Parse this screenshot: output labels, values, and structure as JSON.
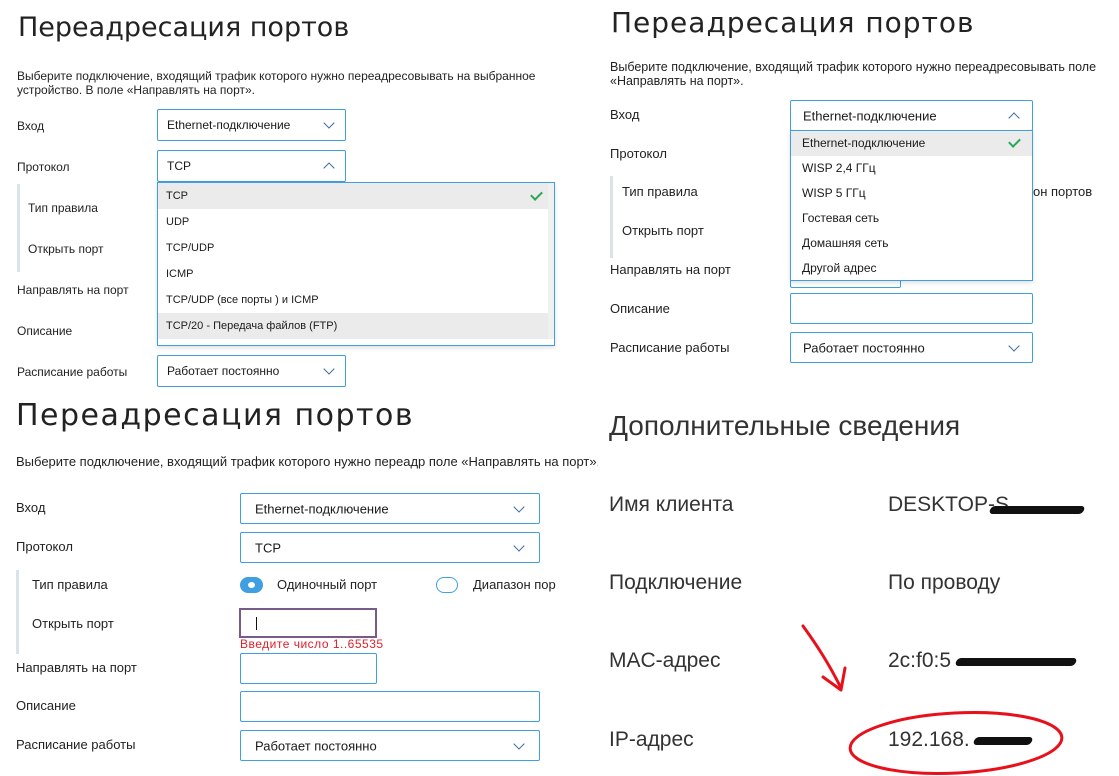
{
  "panels": [
    {
      "title": "Переадресация портов",
      "description": "Выберите подключение, входящий трафик которого нужно переадресовывать на выбранное устройство. В поле «Направлять на порт».",
      "labels": {
        "input": "Вход",
        "protocol": "Протокол",
        "rule_type": "Тип правила",
        "open_port": "Открыть порт",
        "forward_port": "Направлять на порт",
        "comment": "Описание",
        "schedule": "Расписание работы"
      },
      "input_value": "Ethernet-подключение",
      "protocol_value": "TCP",
      "schedule_value": "Работает постоянно",
      "protocol_options": [
        "TCP",
        "UDP",
        "TCP/UDP",
        "ICMP",
        "TCP/UDP (все порты ) и ICMP",
        "TCP/20 - Передача файлов (FTP)"
      ]
    },
    {
      "title": "Переадресация портов",
      "description": "Выберите подключение, входящий трафик которого нужно переадресовывать поле «Направлять на порт».",
      "labels": {
        "input": "Вход",
        "protocol": "Протокол",
        "rule_type": "Тип правила",
        "open_port": "Открыть порт",
        "forward_port": "Направлять на порт",
        "comment": "Описание",
        "schedule": "Расписание работы"
      },
      "input_value": "Ethernet-подключение",
      "schedule_value": "Работает постоянно",
      "range_partial": "он портов",
      "input_options": [
        "Ethernet-подключение",
        "WISP 2,4 ГГц",
        "WISP 5 ГГц",
        "Гостевая сеть",
        "Домашняя сеть",
        "Другой адрес"
      ]
    },
    {
      "title": "Переадресация портов",
      "description": "Выберите подключение, входящий трафик которого нужно переадр поле «Направлять на порт».",
      "labels": {
        "input": "Вход",
        "protocol": "Протокол",
        "rule_type": "Тип правила",
        "open_port": "Открыть порт",
        "forward_port": "Направлять на порт",
        "comment": "Описание",
        "schedule": "Расписание работы"
      },
      "input_value": "Ethernet-подключение",
      "protocol_value": "TCP",
      "schedule_value": "Работает постоянно",
      "rule_single": "Одиночный порт",
      "rule_range": "Диапазон пор",
      "error": "Введите число 1..65535"
    }
  ],
  "info": {
    "title": "Дополнительные сведения",
    "rows": [
      {
        "label": "Имя клиента",
        "value": "DESKTOP-S"
      },
      {
        "label": "Подключение",
        "value": "По проводу"
      },
      {
        "label": "MAC-адрес",
        "value": "2c:f0:5"
      },
      {
        "label": "IP-адрес",
        "value": "192.168."
      }
    ]
  },
  "colors": {
    "accent": "#3f9fe0",
    "error": "#e0202a",
    "annotation": "#e8101a",
    "check": "#2aa85a"
  }
}
